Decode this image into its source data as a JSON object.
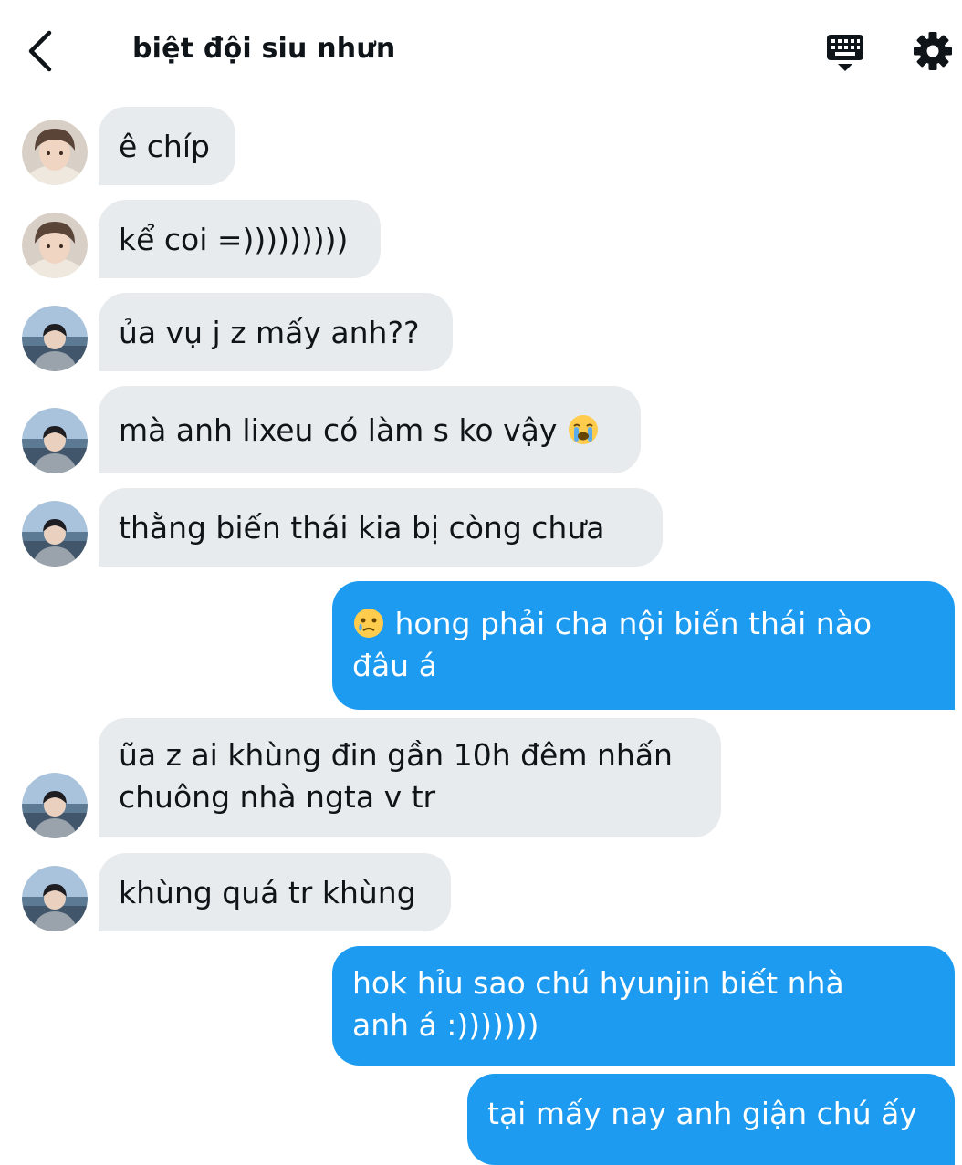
{
  "header": {
    "title": "biệt đội siu nhưn",
    "back_icon": "chevron-left-icon",
    "keyboard_icon": "keyboard-icon",
    "settings_icon": "gear-icon"
  },
  "colors": {
    "incoming_bubble": "#e7ebee",
    "outgoing_bubble": "#1d9bf0",
    "text": "#0f1419"
  },
  "messages": [
    {
      "direction": "in",
      "sender": "friend-1",
      "text": "ê chíp"
    },
    {
      "direction": "in",
      "sender": "friend-1",
      "text": "kể coi =)))))))))"
    },
    {
      "direction": "in",
      "sender": "friend-2",
      "text": "ủa vụ j z mấy anh??"
    },
    {
      "direction": "in",
      "sender": "friend-2",
      "text": "mà anh lixeu có làm s ko vậy",
      "emoji": "loudly-crying-face-icon"
    },
    {
      "direction": "in",
      "sender": "friend-2",
      "text": "thằng biến thái kia bị còng chưa"
    },
    {
      "direction": "out",
      "emoji": "face-holding-back-tears-icon",
      "line1": "hong phải cha nội biến thái nào",
      "line2": "đâu á"
    },
    {
      "direction": "in",
      "sender": "friend-2",
      "line1": "ũa z ai khùng đin gần 10h đêm nhấn",
      "line2": "chuông nhà ngta v tr"
    },
    {
      "direction": "in",
      "sender": "friend-2",
      "text": "khùng quá tr khùng"
    },
    {
      "direction": "out",
      "line1": "hok hỉu sao chú hyunjin biết nhà",
      "line2": "anh á :)))))))"
    },
    {
      "direction": "out",
      "text": "tại mấy nay anh giận chú ấy"
    }
  ]
}
